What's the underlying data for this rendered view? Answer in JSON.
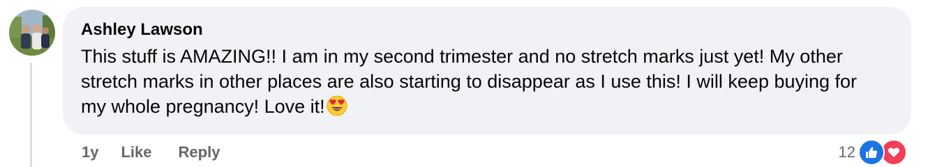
{
  "comment": {
    "author": "Ashley Lawson",
    "text": "This stuff is AMAZING!! I am in my second trimester and no stretch marks just yet! My other stretch marks in other places are also starting to disappear as I use this! I will keep buying for my whole pregnancy! Love it!",
    "emoji": "heart-eyes-emoji",
    "avatar": "profile-photo"
  },
  "actions": {
    "time": "1y",
    "like": "Like",
    "reply": "Reply"
  },
  "reactions": {
    "count": "12",
    "icons": [
      "like-reaction-icon",
      "love-reaction-icon"
    ],
    "colors": {
      "like": "#1b74e4",
      "love": "#f33e58"
    }
  },
  "colors": {
    "bubble": "#f0f2f5",
    "text": "#050505",
    "secondary": "#65676b"
  }
}
